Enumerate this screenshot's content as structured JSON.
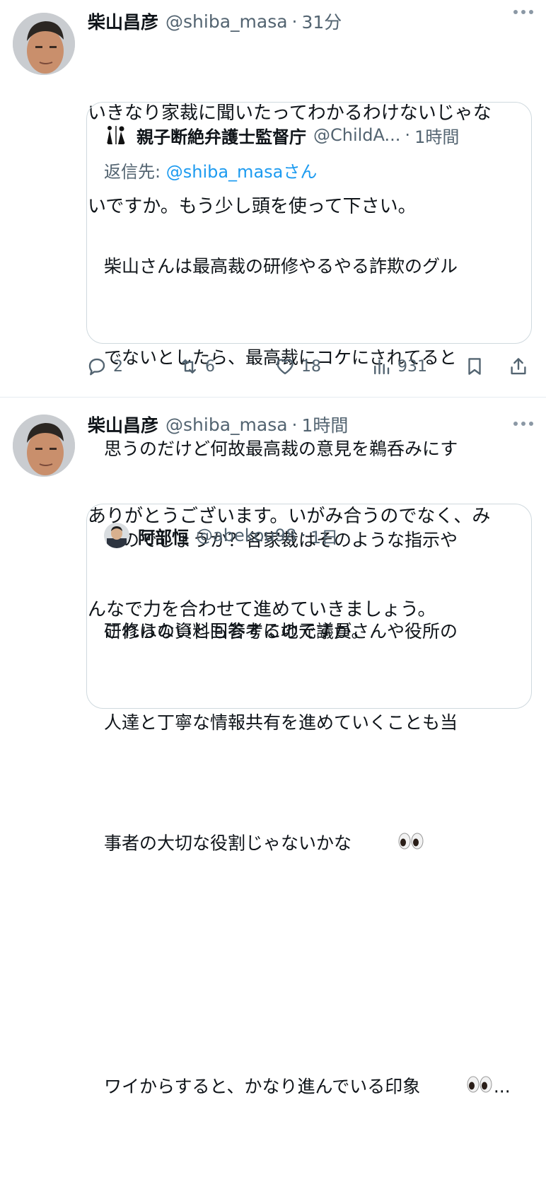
{
  "tweets": [
    {
      "name": "柴山昌彦",
      "handle": "@shiba_masa",
      "time": "31分",
      "text": "いきなり家裁に聞いたってわかるわけないじゃないですか。もう少し頭を使って下さい。",
      "text_lines": [
        "いきなり家裁に聞いたってわかるわけないじゃな",
        "いですか。もう少し頭を使って下さい。"
      ],
      "quote": {
        "name": "親子断絶弁護士監督庁",
        "handle": "@ChildA...",
        "time": "1時間",
        "reply_label": "返信先:",
        "reply_mention": "@shiba_masa",
        "reply_suffix": "さん",
        "text_lines": [
          "柴山さんは最高裁の研修やるやる詐欺のグル",
          "でないとしたら、最高裁にコケにされてると",
          "思うのだけど何故最高裁の意見を鵜呑みにす",
          "るのでしょうか？各家裁はそのような指示や",
          "研修はないと回答するのですが。"
        ]
      },
      "stats": {
        "replies": "2",
        "retweets": "6",
        "likes": "18",
        "views": "931"
      }
    },
    {
      "name": "柴山昌彦",
      "handle": "@shiba_masa",
      "time": "1時間",
      "text_lines": [
        "ありがとうございます。いがみ合うのでなく、み",
        "んなで力を合わせて進めていきましょう。"
      ],
      "quote": {
        "name": "阿部恒",
        "handle": "@abekou98",
        "time": "1日",
        "text_lines": [
          "これらの資料も参考に地元議員さんや役所の",
          "人達と丁寧な情報共有を進めていくことも当",
          "事者の大切な役割じゃないかな",
          "",
          "ワイからすると、かなり進んでいる印象"
        ],
        "line3_emoji": "eyes",
        "line5_emoji": "eyes",
        "line5_suffix": "..."
      }
    }
  ],
  "icons": [
    "reply-icon",
    "retweet-icon",
    "like-icon",
    "views-icon",
    "bookmark-icon",
    "share-icon",
    "more-icon"
  ],
  "colors": {
    "text": "#0f1419",
    "secondary": "#536471",
    "link": "#1d9bf0",
    "border": "#cfd9de"
  }
}
